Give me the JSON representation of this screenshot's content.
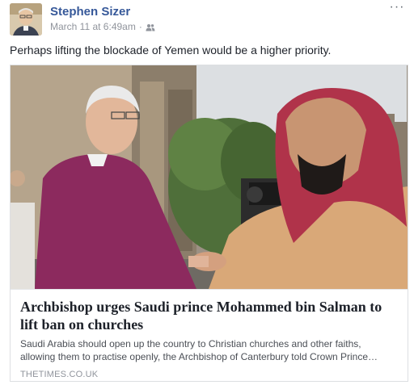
{
  "post": {
    "author": "Stephen Sizer",
    "timestamp": "March 11 at 6:49am",
    "separator": "·",
    "audience_icon": "friends-icon",
    "more_label": "···",
    "text": "Perhaps lifting the blockade of Yemen would be a higher priority."
  },
  "link": {
    "title": "Archbishop urges Saudi prince Mohammed bin Salman to lift ban on churches",
    "description": "Saudi Arabia should open up the country to Christian churches and other faiths, allowing them to practise openly, the Archbishop of Canterbury told Crown Prince…",
    "domain": "THETIMES.CO.UK"
  },
  "colors": {
    "author_link": "#365899",
    "meta_text": "#90949c",
    "body_text": "#1d2129",
    "card_border": "#dddfe2"
  }
}
